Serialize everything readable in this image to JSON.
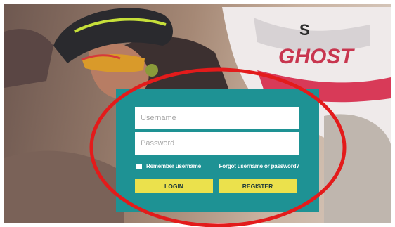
{
  "background": {
    "bike_brand_text": "GHOST",
    "jersey_text": "S"
  },
  "login_form": {
    "username_placeholder": "Username",
    "password_placeholder": "Password",
    "remember_label": "Remember username",
    "forgot_link": "Forgot username or password?",
    "login_button": "LOGIN",
    "register_button": "REGISTER"
  },
  "colors": {
    "panel": "#1e9294",
    "button": "#ebe14c",
    "highlight_ring": "#e31b1b"
  }
}
